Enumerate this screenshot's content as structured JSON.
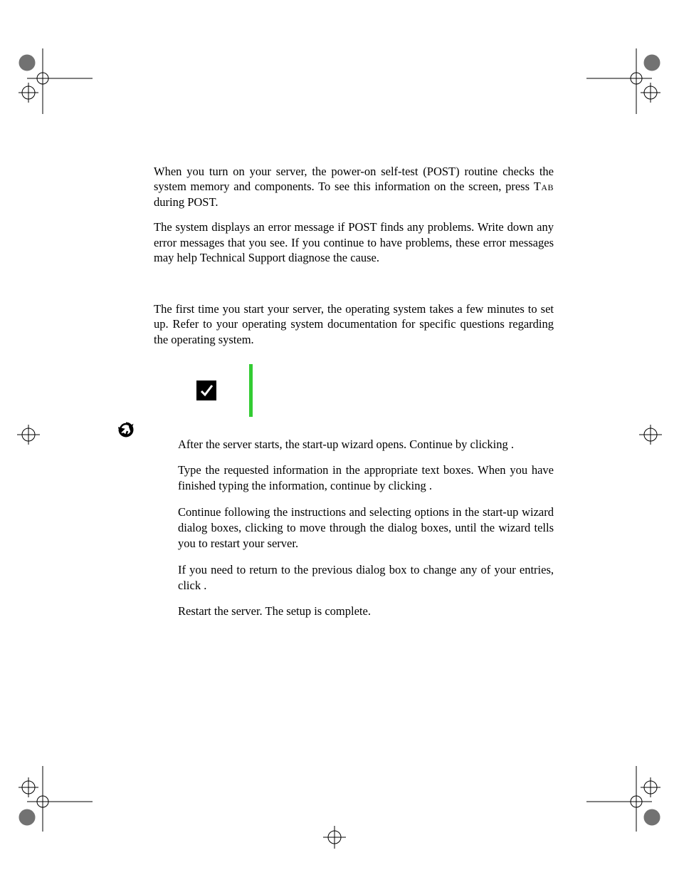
{
  "para1_a": "When you turn on your server, the power-on self-test (POST) routine checks the system memory and components. To see this information on the screen, press ",
  "para1_key": "Tab",
  "para1_b": " during POST.",
  "para2": "The system displays an error message if POST finds any problems. Write down any error messages that you see. If you continue to have problems, these error messages may help Technical Support diagnose the cause.",
  "para3": "The first time you start your server, the operating system takes a few minutes to set up. Refer to your operating system documentation for specific questions regarding the operating system.",
  "step1": "After the server starts, the start-up wizard opens. Continue by clicking      .",
  "step2": "Type the requested information in the appropriate text boxes. When you have finished typing the information, continue by clicking           .",
  "step3": "Continue following the instructions and selecting options in the start-up wizard dialog boxes, clicking          to move through the dialog boxes, until the wizard tells you to restart your server.",
  "step4": "If you need to return to the previous dialog box to change any of your entries, click          .",
  "step5": "Restart the server. The setup is complete."
}
